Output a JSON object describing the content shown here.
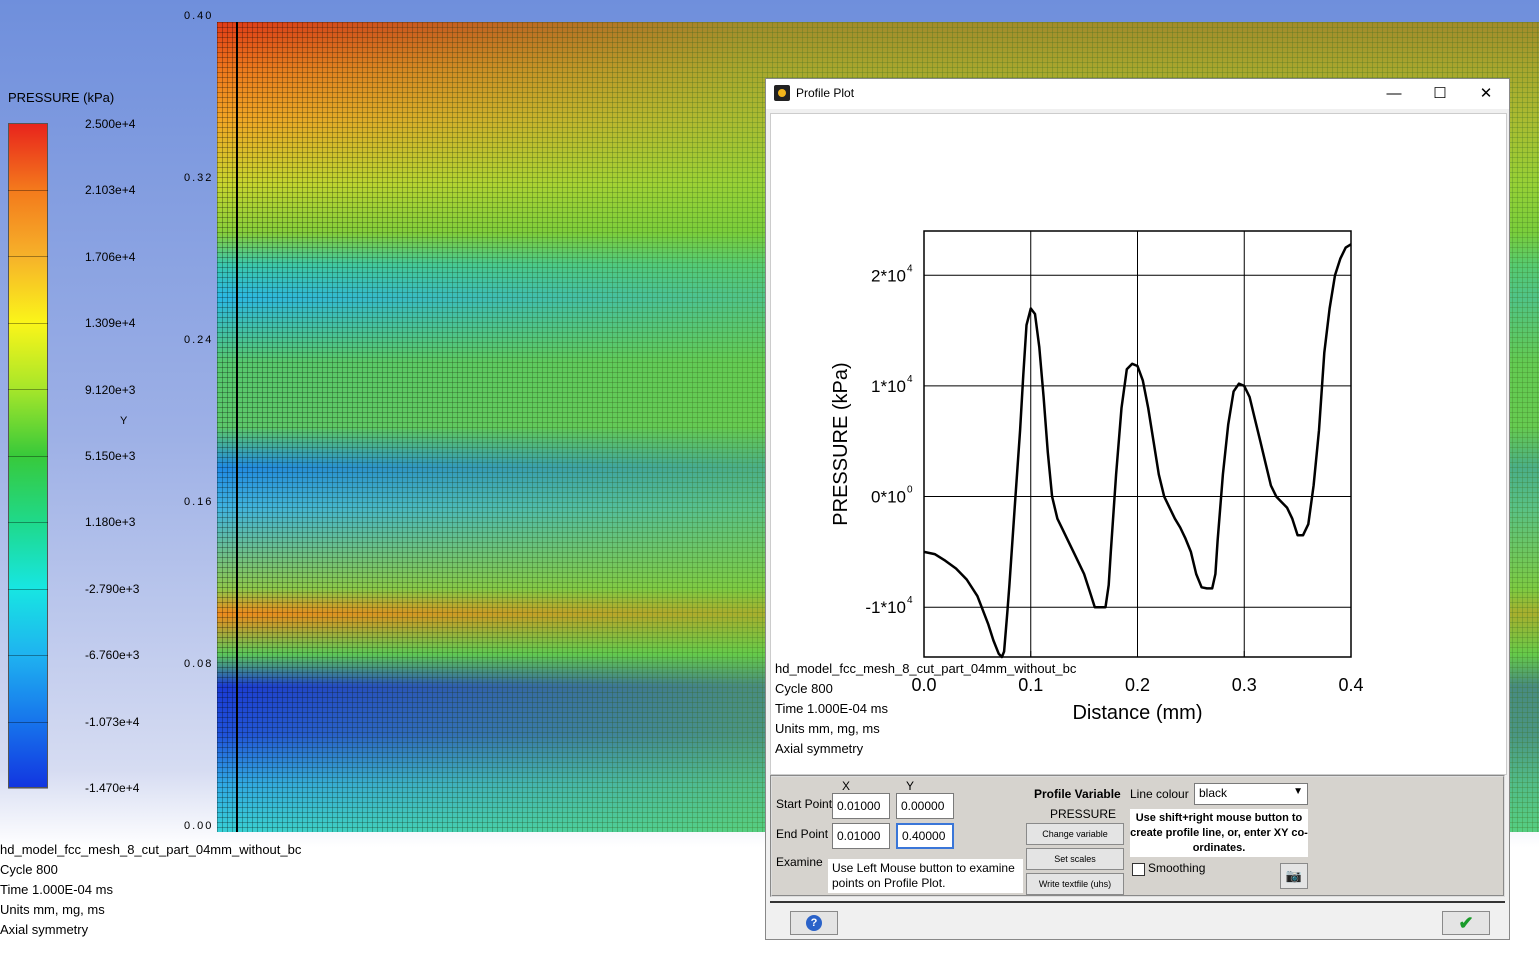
{
  "legend": {
    "title": "PRESSURE (kPa)",
    "ticks": [
      "2.500e+4",
      "2.103e+4",
      "1.706e+4",
      "1.309e+4",
      "9.120e+3",
      "5.150e+3",
      "1.180e+3",
      "-2.790e+3",
      "-6.760e+3",
      "-1.073e+4",
      "-1.470e+4"
    ],
    "axis_letter": "Y",
    "colors": [
      "#e8241c",
      "#f47a1c",
      "#f6b22a",
      "#fbf519",
      "#a6e62a",
      "#38c93a",
      "#1fd98a",
      "#17e6e2",
      "#1fb3f0",
      "#1775ec",
      "#1236e0"
    ]
  },
  "y_axis_ticks": [
    "0.40",
    "0.32",
    "0.24",
    "0.16",
    "0.08",
    "0.00"
  ],
  "model_info": {
    "name": "hd_model_fcc_mesh_8_cut_part_04mm_without_bc",
    "cycle": "Cycle 800",
    "time": "Time 1.000E-04 ms",
    "units": "Units mm, mg, ms",
    "symmetry": "Axial symmetry"
  },
  "dialog": {
    "title": "Profile Plot",
    "minimize": "—",
    "maximize": "☐",
    "close": "✕",
    "info": {
      "name": "hd_model_fcc_mesh_8_cut_part_04mm_without_bc",
      "cycle": "Cycle 800",
      "time": "Time 1.000E-04 ms",
      "units": "Units mm, mg, ms",
      "symmetry": "Axial symmetry"
    },
    "controls": {
      "x_header": "X",
      "y_header": "Y",
      "start_label": "Start Point",
      "end_label": "End Point",
      "examine_label": "Examine",
      "start_x": "0.01000",
      "start_y": "0.00000",
      "end_x": "0.01000",
      "end_y": "0.40000",
      "examine_note": "Use Left Mouse button to examine points on Profile Plot.",
      "profile_variable_label": "Profile Variable",
      "profile_variable": "PRESSURE",
      "change_variable": "Change variable",
      "set_scales": "Set scales",
      "write_textfile": "Write textfile (uhs)",
      "line_colour_label": "Line colour",
      "line_colour": "black",
      "hint": "Use shift+right mouse button to create profile line, or, enter XY co-ordinates.",
      "smoothing_label": "Smoothing",
      "smoothing_checked": false
    },
    "help": "?",
    "ok": "✔"
  },
  "chart_data": {
    "type": "line",
    "title": "",
    "xlabel": "Distance (mm)",
    "ylabel": "PRESSURE  (kPa)",
    "xlim": [
      0.0,
      0.4
    ],
    "ylim": [
      -14500,
      24000
    ],
    "x_ticks": [
      "0.0",
      "0.1",
      "0.2",
      "0.3",
      "0.4"
    ],
    "x_tick_values": [
      0.0,
      0.1,
      0.2,
      0.3,
      0.4
    ],
    "y_ticks": [
      {
        "value": 20000,
        "base": "2*10",
        "exp": "4"
      },
      {
        "value": 10000,
        "base": "1*10",
        "exp": "4"
      },
      {
        "value": 0,
        "base": "0*10",
        "exp": "0"
      },
      {
        "value": -10000,
        "base": "-1*10",
        "exp": "4"
      }
    ],
    "grid": true,
    "line_color": "#000000",
    "series": [
      {
        "x": [
          0.0,
          0.01,
          0.02,
          0.03,
          0.04,
          0.05,
          0.06,
          0.065,
          0.07,
          0.073,
          0.075,
          0.078,
          0.08,
          0.085,
          0.09,
          0.093,
          0.096,
          0.1,
          0.104,
          0.108,
          0.112,
          0.116,
          0.12,
          0.125,
          0.13,
          0.135,
          0.14,
          0.145,
          0.15,
          0.155,
          0.16,
          0.165,
          0.17,
          0.173,
          0.175,
          0.18,
          0.185,
          0.19,
          0.195,
          0.2,
          0.205,
          0.21,
          0.215,
          0.22,
          0.225,
          0.23,
          0.235,
          0.24,
          0.245,
          0.25,
          0.255,
          0.26,
          0.265,
          0.27,
          0.273,
          0.275,
          0.28,
          0.285,
          0.29,
          0.295,
          0.3,
          0.305,
          0.31,
          0.315,
          0.32,
          0.325,
          0.33,
          0.335,
          0.34,
          0.345,
          0.35,
          0.355,
          0.36,
          0.365,
          0.37,
          0.375,
          0.38,
          0.385,
          0.39,
          0.395,
          0.4
        ],
        "y": [
          -5000,
          -5200,
          -5800,
          -6500,
          -7500,
          -9000,
          -11500,
          -13000,
          -14200,
          -14500,
          -14000,
          -10500,
          -8000,
          -1000,
          6000,
          11000,
          15500,
          17000,
          16500,
          13500,
          9000,
          4000,
          0,
          -2000,
          -3000,
          -4000,
          -5000,
          -6000,
          -7000,
          -8500,
          -10000,
          -10000,
          -10000,
          -8000,
          -5000,
          2000,
          8000,
          11500,
          12000,
          11800,
          10500,
          8000,
          5000,
          2000,
          0,
          -1000,
          -2000,
          -2800,
          -3800,
          -5000,
          -7000,
          -8200,
          -8300,
          -8300,
          -7000,
          -4000,
          2000,
          6500,
          9500,
          10200,
          10000,
          9000,
          7000,
          5000,
          3000,
          1000,
          0,
          -500,
          -1000,
          -2000,
          -3500,
          -3500,
          -2500,
          1000,
          6000,
          13000,
          17000,
          20000,
          21500,
          22500,
          22800
        ]
      }
    ]
  }
}
